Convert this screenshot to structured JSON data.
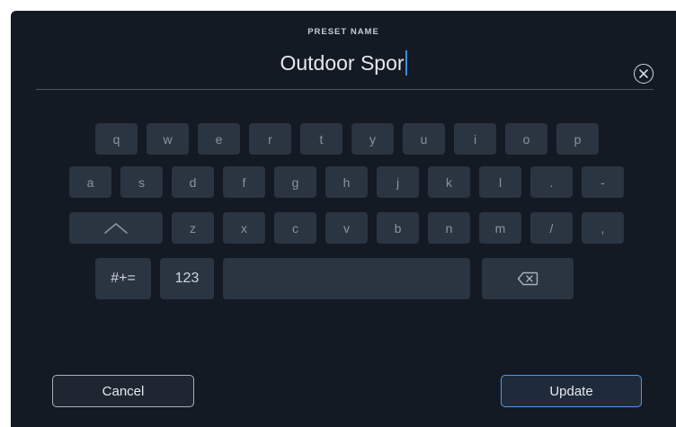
{
  "header": {
    "label": "PRESET NAME",
    "value": "Outdoor Spor"
  },
  "keyboard": {
    "row1": [
      "q",
      "w",
      "e",
      "r",
      "t",
      "y",
      "u",
      "i",
      "o",
      "p"
    ],
    "row2": [
      "a",
      "s",
      "d",
      "f",
      "g",
      "h",
      "j",
      "k",
      "l",
      ".",
      "-"
    ],
    "row3": [
      "z",
      "x",
      "c",
      "v",
      "b",
      "n",
      "m",
      "/",
      ","
    ],
    "symbols_label": "#+=",
    "numbers_label": "123"
  },
  "actions": {
    "cancel_label": "Cancel",
    "update_label": "Update"
  },
  "icons": {
    "clear": "clear-circle-x-icon",
    "shift": "shift-caret-icon",
    "backspace": "backspace-icon"
  },
  "colors": {
    "background": "#131a23",
    "key": "#2b3441",
    "accent": "#3a8ee6"
  }
}
